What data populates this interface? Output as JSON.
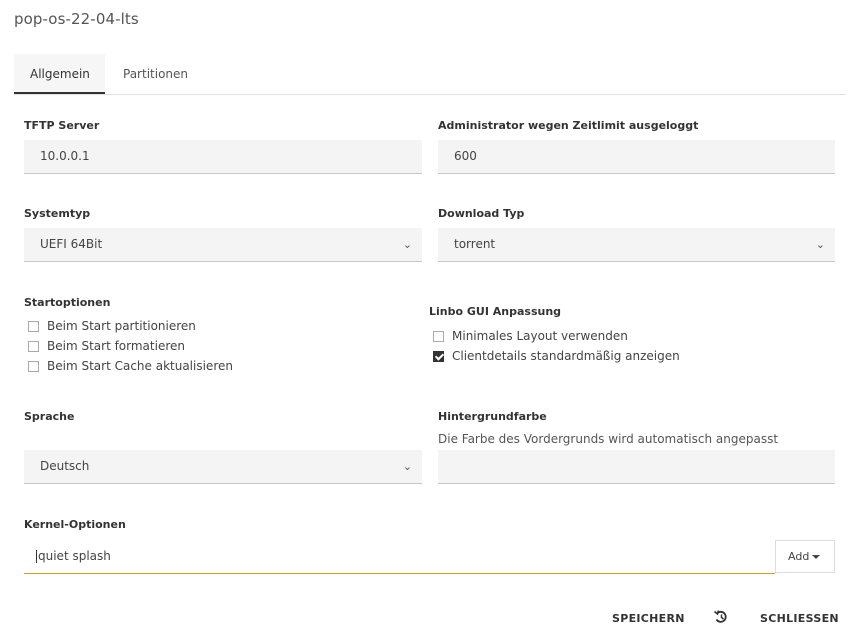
{
  "page": {
    "title": "pop-os-22-04-lts"
  },
  "tabs": [
    {
      "label": "Allgemein",
      "active": true
    },
    {
      "label": "Partitionen",
      "active": false
    }
  ],
  "tftp": {
    "label": "TFTP Server",
    "value": "10.0.0.1"
  },
  "admin_timeout": {
    "label": "Administrator wegen Zeitlimit ausgeloggt",
    "value": "600"
  },
  "systemtyp": {
    "label": "Systemtyp",
    "value": "UEFI 64Bit"
  },
  "download_typ": {
    "label": "Download Typ",
    "value": "torrent"
  },
  "startoptionen": {
    "label": "Startoptionen",
    "items": [
      {
        "label": "Beim Start partitionieren",
        "checked": false
      },
      {
        "label": "Beim Start formatieren",
        "checked": false
      },
      {
        "label": "Beim Start Cache aktualisieren",
        "checked": false
      }
    ]
  },
  "linbo_gui": {
    "label": "Linbo GUI Anpassung",
    "items": [
      {
        "label": "Minimales Layout verwenden",
        "checked": false
      },
      {
        "label": "Clientdetails standardmäßig anzeigen",
        "checked": true
      }
    ]
  },
  "sprache": {
    "label": "Sprache",
    "value": "Deutsch"
  },
  "hintergrundfarbe": {
    "label": "Hintergrundfarbe",
    "hint": "Die Farbe des Vordergrunds wird automatisch angepasst",
    "value": ""
  },
  "kernel": {
    "label": "Kernel-Optionen",
    "value": "quiet splash",
    "add_label": "Add"
  },
  "footer": {
    "save": "SPEICHERN",
    "reset_icon": "history-icon",
    "close": "SCHLIESSEN"
  },
  "colors": {
    "focus_underline": "#d4a017",
    "checkbox_checked": "#333333"
  }
}
